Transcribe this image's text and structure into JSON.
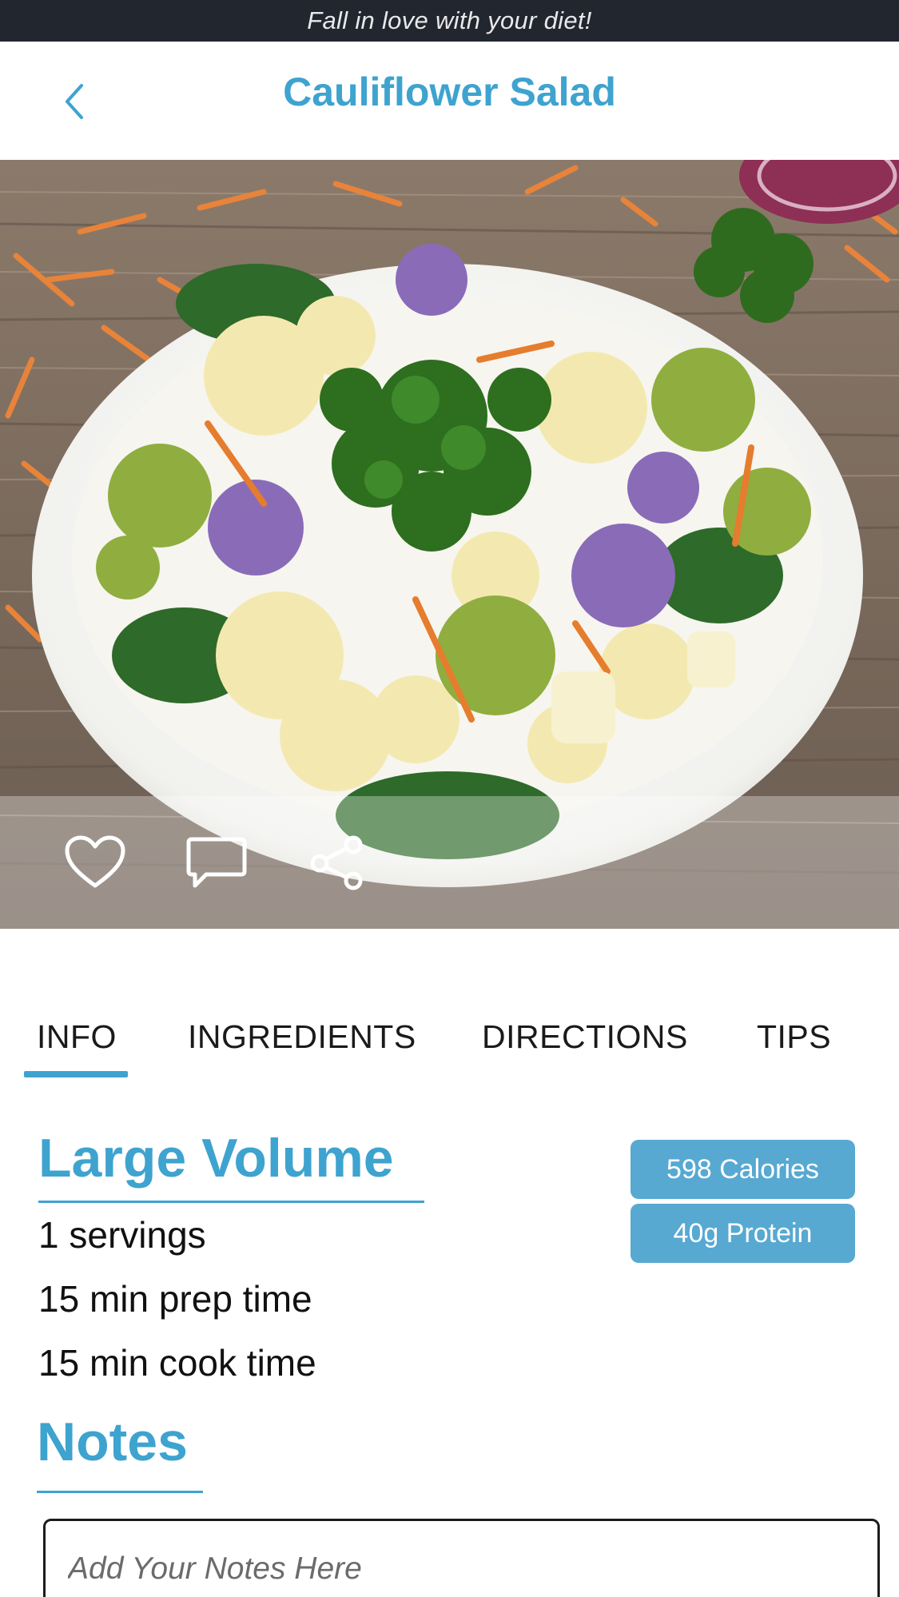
{
  "status_bar": {
    "tagline": "Fall in love with your diet!"
  },
  "header": {
    "title": "Cauliflower Salad",
    "back_icon": "chevron-left-icon"
  },
  "hero": {
    "alt": "Cauliflower salad in a white bowl",
    "actions": [
      {
        "name": "like",
        "icon": "heart-icon"
      },
      {
        "name": "comment",
        "icon": "comment-icon"
      },
      {
        "name": "share",
        "icon": "share-icon"
      }
    ]
  },
  "tabs": [
    {
      "label": "INFO",
      "active": true
    },
    {
      "label": "INGREDIENTS",
      "active": false
    },
    {
      "label": "DIRECTIONS",
      "active": false
    },
    {
      "label": "TIPS",
      "active": false
    }
  ],
  "info": {
    "heading": "Large Volume",
    "servings": "1 servings",
    "prep_time": "15 min prep time",
    "cook_time": "15 min cook time",
    "badges": {
      "calories": "598 Calories",
      "protein": "40g Protein"
    }
  },
  "notes": {
    "heading": "Notes",
    "placeholder": "Add Your Notes Here"
  },
  "colors": {
    "accent": "#3ea3cf",
    "badge": "#57a9d2",
    "top_bar": "#22262e"
  }
}
